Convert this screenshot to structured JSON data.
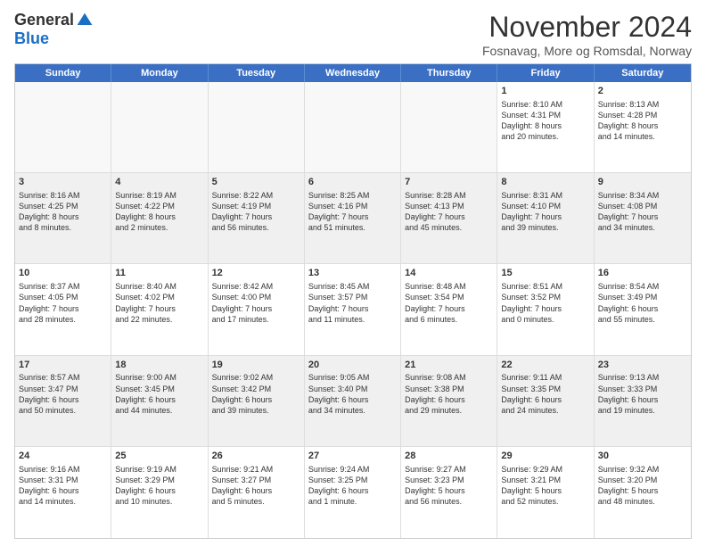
{
  "logo": {
    "general": "General",
    "blue": "Blue"
  },
  "title": "November 2024",
  "location": "Fosnavag, More og Romsdal, Norway",
  "header_days": [
    "Sunday",
    "Monday",
    "Tuesday",
    "Wednesday",
    "Thursday",
    "Friday",
    "Saturday"
  ],
  "rows": [
    [
      {
        "day": "",
        "text": "",
        "empty": true
      },
      {
        "day": "",
        "text": "",
        "empty": true
      },
      {
        "day": "",
        "text": "",
        "empty": true
      },
      {
        "day": "",
        "text": "",
        "empty": true
      },
      {
        "day": "",
        "text": "",
        "empty": true
      },
      {
        "day": "1",
        "text": "Sunrise: 8:10 AM\nSunset: 4:31 PM\nDaylight: 8 hours\nand 20 minutes.",
        "empty": false
      },
      {
        "day": "2",
        "text": "Sunrise: 8:13 AM\nSunset: 4:28 PM\nDaylight: 8 hours\nand 14 minutes.",
        "empty": false
      }
    ],
    [
      {
        "day": "3",
        "text": "Sunrise: 8:16 AM\nSunset: 4:25 PM\nDaylight: 8 hours\nand 8 minutes.",
        "empty": false,
        "shaded": true
      },
      {
        "day": "4",
        "text": "Sunrise: 8:19 AM\nSunset: 4:22 PM\nDaylight: 8 hours\nand 2 minutes.",
        "empty": false,
        "shaded": true
      },
      {
        "day": "5",
        "text": "Sunrise: 8:22 AM\nSunset: 4:19 PM\nDaylight: 7 hours\nand 56 minutes.",
        "empty": false,
        "shaded": true
      },
      {
        "day": "6",
        "text": "Sunrise: 8:25 AM\nSunset: 4:16 PM\nDaylight: 7 hours\nand 51 minutes.",
        "empty": false,
        "shaded": true
      },
      {
        "day": "7",
        "text": "Sunrise: 8:28 AM\nSunset: 4:13 PM\nDaylight: 7 hours\nand 45 minutes.",
        "empty": false,
        "shaded": true
      },
      {
        "day": "8",
        "text": "Sunrise: 8:31 AM\nSunset: 4:10 PM\nDaylight: 7 hours\nand 39 minutes.",
        "empty": false,
        "shaded": true
      },
      {
        "day": "9",
        "text": "Sunrise: 8:34 AM\nSunset: 4:08 PM\nDaylight: 7 hours\nand 34 minutes.",
        "empty": false,
        "shaded": true
      }
    ],
    [
      {
        "day": "10",
        "text": "Sunrise: 8:37 AM\nSunset: 4:05 PM\nDaylight: 7 hours\nand 28 minutes.",
        "empty": false
      },
      {
        "day": "11",
        "text": "Sunrise: 8:40 AM\nSunset: 4:02 PM\nDaylight: 7 hours\nand 22 minutes.",
        "empty": false
      },
      {
        "day": "12",
        "text": "Sunrise: 8:42 AM\nSunset: 4:00 PM\nDaylight: 7 hours\nand 17 minutes.",
        "empty": false
      },
      {
        "day": "13",
        "text": "Sunrise: 8:45 AM\nSunset: 3:57 PM\nDaylight: 7 hours\nand 11 minutes.",
        "empty": false
      },
      {
        "day": "14",
        "text": "Sunrise: 8:48 AM\nSunset: 3:54 PM\nDaylight: 7 hours\nand 6 minutes.",
        "empty": false
      },
      {
        "day": "15",
        "text": "Sunrise: 8:51 AM\nSunset: 3:52 PM\nDaylight: 7 hours\nand 0 minutes.",
        "empty": false
      },
      {
        "day": "16",
        "text": "Sunrise: 8:54 AM\nSunset: 3:49 PM\nDaylight: 6 hours\nand 55 minutes.",
        "empty": false
      }
    ],
    [
      {
        "day": "17",
        "text": "Sunrise: 8:57 AM\nSunset: 3:47 PM\nDaylight: 6 hours\nand 50 minutes.",
        "empty": false,
        "shaded": true
      },
      {
        "day": "18",
        "text": "Sunrise: 9:00 AM\nSunset: 3:45 PM\nDaylight: 6 hours\nand 44 minutes.",
        "empty": false,
        "shaded": true
      },
      {
        "day": "19",
        "text": "Sunrise: 9:02 AM\nSunset: 3:42 PM\nDaylight: 6 hours\nand 39 minutes.",
        "empty": false,
        "shaded": true
      },
      {
        "day": "20",
        "text": "Sunrise: 9:05 AM\nSunset: 3:40 PM\nDaylight: 6 hours\nand 34 minutes.",
        "empty": false,
        "shaded": true
      },
      {
        "day": "21",
        "text": "Sunrise: 9:08 AM\nSunset: 3:38 PM\nDaylight: 6 hours\nand 29 minutes.",
        "empty": false,
        "shaded": true
      },
      {
        "day": "22",
        "text": "Sunrise: 9:11 AM\nSunset: 3:35 PM\nDaylight: 6 hours\nand 24 minutes.",
        "empty": false,
        "shaded": true
      },
      {
        "day": "23",
        "text": "Sunrise: 9:13 AM\nSunset: 3:33 PM\nDaylight: 6 hours\nand 19 minutes.",
        "empty": false,
        "shaded": true
      }
    ],
    [
      {
        "day": "24",
        "text": "Sunrise: 9:16 AM\nSunset: 3:31 PM\nDaylight: 6 hours\nand 14 minutes.",
        "empty": false
      },
      {
        "day": "25",
        "text": "Sunrise: 9:19 AM\nSunset: 3:29 PM\nDaylight: 6 hours\nand 10 minutes.",
        "empty": false
      },
      {
        "day": "26",
        "text": "Sunrise: 9:21 AM\nSunset: 3:27 PM\nDaylight: 6 hours\nand 5 minutes.",
        "empty": false
      },
      {
        "day": "27",
        "text": "Sunrise: 9:24 AM\nSunset: 3:25 PM\nDaylight: 6 hours\nand 1 minute.",
        "empty": false
      },
      {
        "day": "28",
        "text": "Sunrise: 9:27 AM\nSunset: 3:23 PM\nDaylight: 5 hours\nand 56 minutes.",
        "empty": false
      },
      {
        "day": "29",
        "text": "Sunrise: 9:29 AM\nSunset: 3:21 PM\nDaylight: 5 hours\nand 52 minutes.",
        "empty": false
      },
      {
        "day": "30",
        "text": "Sunrise: 9:32 AM\nSunset: 3:20 PM\nDaylight: 5 hours\nand 48 minutes.",
        "empty": false
      }
    ]
  ]
}
